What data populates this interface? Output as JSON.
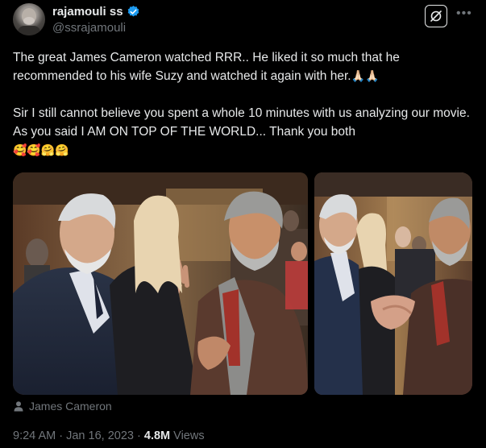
{
  "author": {
    "name": "rajamouli ss",
    "handle": "@ssrajamouli",
    "verified_color": "#1d9bf0",
    "avatar_icon": "user-avatar"
  },
  "tweet": {
    "line1": "The great James Cameron watched RRR.. He liked it so much that he recommended to his wife Suzy and watched it again with her.",
    "line1_emoji": "🙏🏻🙏🏻",
    "line2": "Sir I still cannot believe you spent a whole 10 minutes with us analyzing our movie. As you said I AM ON TOP OF THE WORLD... Thank you both",
    "line2_emoji": "🥰🥰🤗🤗"
  },
  "media": {
    "tag_label": "James Cameron"
  },
  "meta": {
    "time": "9:24 AM",
    "sep1": "·",
    "date": "Jan 16, 2023",
    "sep2": "·",
    "views_count": "4.8M",
    "views_label": "Views"
  },
  "icons": {
    "grok": "grok-icon",
    "more": "more-icon",
    "tag": "person-icon"
  }
}
